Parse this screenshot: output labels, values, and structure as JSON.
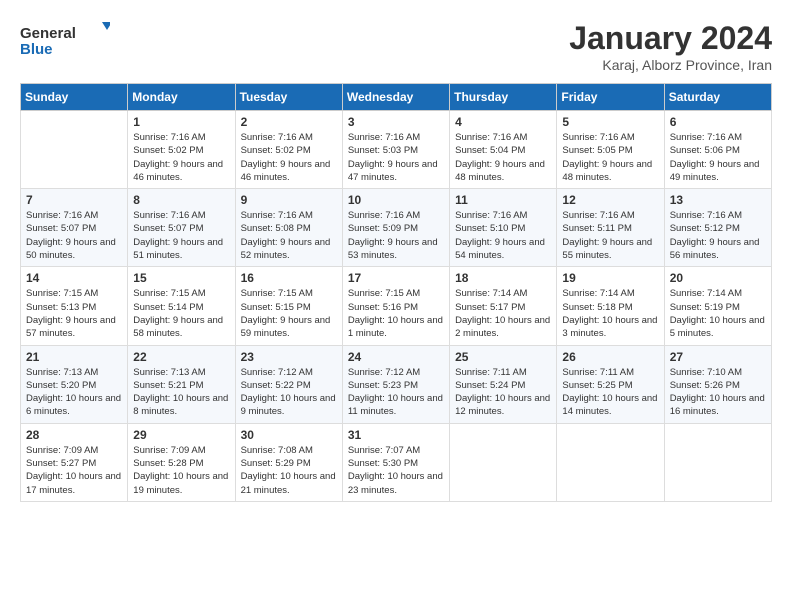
{
  "logo": {
    "text_general": "General",
    "text_blue": "Blue"
  },
  "title": "January 2024",
  "subtitle": "Karaj, Alborz Province, Iran",
  "days_of_week": [
    "Sunday",
    "Monday",
    "Tuesday",
    "Wednesday",
    "Thursday",
    "Friday",
    "Saturday"
  ],
  "weeks": [
    [
      {
        "day": "",
        "sunrise": "",
        "sunset": "",
        "daylight": ""
      },
      {
        "day": "1",
        "sunrise": "Sunrise: 7:16 AM",
        "sunset": "Sunset: 5:02 PM",
        "daylight": "Daylight: 9 hours and 46 minutes."
      },
      {
        "day": "2",
        "sunrise": "Sunrise: 7:16 AM",
        "sunset": "Sunset: 5:02 PM",
        "daylight": "Daylight: 9 hours and 46 minutes."
      },
      {
        "day": "3",
        "sunrise": "Sunrise: 7:16 AM",
        "sunset": "Sunset: 5:03 PM",
        "daylight": "Daylight: 9 hours and 47 minutes."
      },
      {
        "day": "4",
        "sunrise": "Sunrise: 7:16 AM",
        "sunset": "Sunset: 5:04 PM",
        "daylight": "Daylight: 9 hours and 48 minutes."
      },
      {
        "day": "5",
        "sunrise": "Sunrise: 7:16 AM",
        "sunset": "Sunset: 5:05 PM",
        "daylight": "Daylight: 9 hours and 48 minutes."
      },
      {
        "day": "6",
        "sunrise": "Sunrise: 7:16 AM",
        "sunset": "Sunset: 5:06 PM",
        "daylight": "Daylight: 9 hours and 49 minutes."
      }
    ],
    [
      {
        "day": "7",
        "sunrise": "Sunrise: 7:16 AM",
        "sunset": "Sunset: 5:07 PM",
        "daylight": "Daylight: 9 hours and 50 minutes."
      },
      {
        "day": "8",
        "sunrise": "Sunrise: 7:16 AM",
        "sunset": "Sunset: 5:07 PM",
        "daylight": "Daylight: 9 hours and 51 minutes."
      },
      {
        "day": "9",
        "sunrise": "Sunrise: 7:16 AM",
        "sunset": "Sunset: 5:08 PM",
        "daylight": "Daylight: 9 hours and 52 minutes."
      },
      {
        "day": "10",
        "sunrise": "Sunrise: 7:16 AM",
        "sunset": "Sunset: 5:09 PM",
        "daylight": "Daylight: 9 hours and 53 minutes."
      },
      {
        "day": "11",
        "sunrise": "Sunrise: 7:16 AM",
        "sunset": "Sunset: 5:10 PM",
        "daylight": "Daylight: 9 hours and 54 minutes."
      },
      {
        "day": "12",
        "sunrise": "Sunrise: 7:16 AM",
        "sunset": "Sunset: 5:11 PM",
        "daylight": "Daylight: 9 hours and 55 minutes."
      },
      {
        "day": "13",
        "sunrise": "Sunrise: 7:16 AM",
        "sunset": "Sunset: 5:12 PM",
        "daylight": "Daylight: 9 hours and 56 minutes."
      }
    ],
    [
      {
        "day": "14",
        "sunrise": "Sunrise: 7:15 AM",
        "sunset": "Sunset: 5:13 PM",
        "daylight": "Daylight: 9 hours and 57 minutes."
      },
      {
        "day": "15",
        "sunrise": "Sunrise: 7:15 AM",
        "sunset": "Sunset: 5:14 PM",
        "daylight": "Daylight: 9 hours and 58 minutes."
      },
      {
        "day": "16",
        "sunrise": "Sunrise: 7:15 AM",
        "sunset": "Sunset: 5:15 PM",
        "daylight": "Daylight: 9 hours and 59 minutes."
      },
      {
        "day": "17",
        "sunrise": "Sunrise: 7:15 AM",
        "sunset": "Sunset: 5:16 PM",
        "daylight": "Daylight: 10 hours and 1 minute."
      },
      {
        "day": "18",
        "sunrise": "Sunrise: 7:14 AM",
        "sunset": "Sunset: 5:17 PM",
        "daylight": "Daylight: 10 hours and 2 minutes."
      },
      {
        "day": "19",
        "sunrise": "Sunrise: 7:14 AM",
        "sunset": "Sunset: 5:18 PM",
        "daylight": "Daylight: 10 hours and 3 minutes."
      },
      {
        "day": "20",
        "sunrise": "Sunrise: 7:14 AM",
        "sunset": "Sunset: 5:19 PM",
        "daylight": "Daylight: 10 hours and 5 minutes."
      }
    ],
    [
      {
        "day": "21",
        "sunrise": "Sunrise: 7:13 AM",
        "sunset": "Sunset: 5:20 PM",
        "daylight": "Daylight: 10 hours and 6 minutes."
      },
      {
        "day": "22",
        "sunrise": "Sunrise: 7:13 AM",
        "sunset": "Sunset: 5:21 PM",
        "daylight": "Daylight: 10 hours and 8 minutes."
      },
      {
        "day": "23",
        "sunrise": "Sunrise: 7:12 AM",
        "sunset": "Sunset: 5:22 PM",
        "daylight": "Daylight: 10 hours and 9 minutes."
      },
      {
        "day": "24",
        "sunrise": "Sunrise: 7:12 AM",
        "sunset": "Sunset: 5:23 PM",
        "daylight": "Daylight: 10 hours and 11 minutes."
      },
      {
        "day": "25",
        "sunrise": "Sunrise: 7:11 AM",
        "sunset": "Sunset: 5:24 PM",
        "daylight": "Daylight: 10 hours and 12 minutes."
      },
      {
        "day": "26",
        "sunrise": "Sunrise: 7:11 AM",
        "sunset": "Sunset: 5:25 PM",
        "daylight": "Daylight: 10 hours and 14 minutes."
      },
      {
        "day": "27",
        "sunrise": "Sunrise: 7:10 AM",
        "sunset": "Sunset: 5:26 PM",
        "daylight": "Daylight: 10 hours and 16 minutes."
      }
    ],
    [
      {
        "day": "28",
        "sunrise": "Sunrise: 7:09 AM",
        "sunset": "Sunset: 5:27 PM",
        "daylight": "Daylight: 10 hours and 17 minutes."
      },
      {
        "day": "29",
        "sunrise": "Sunrise: 7:09 AM",
        "sunset": "Sunset: 5:28 PM",
        "daylight": "Daylight: 10 hours and 19 minutes."
      },
      {
        "day": "30",
        "sunrise": "Sunrise: 7:08 AM",
        "sunset": "Sunset: 5:29 PM",
        "daylight": "Daylight: 10 hours and 21 minutes."
      },
      {
        "day": "31",
        "sunrise": "Sunrise: 7:07 AM",
        "sunset": "Sunset: 5:30 PM",
        "daylight": "Daylight: 10 hours and 23 minutes."
      },
      {
        "day": "",
        "sunrise": "",
        "sunset": "",
        "daylight": ""
      },
      {
        "day": "",
        "sunrise": "",
        "sunset": "",
        "daylight": ""
      },
      {
        "day": "",
        "sunrise": "",
        "sunset": "",
        "daylight": ""
      }
    ]
  ]
}
